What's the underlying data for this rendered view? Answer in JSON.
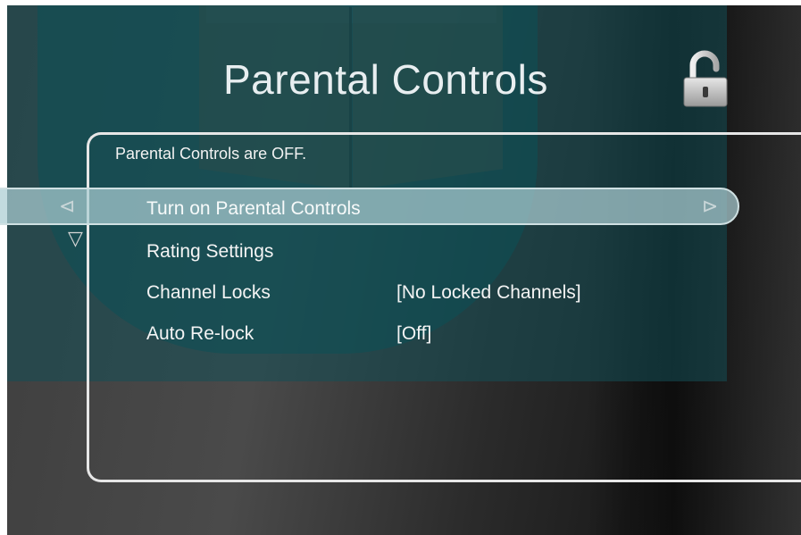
{
  "screen": {
    "title": "Parental Controls",
    "status_text": "Parental Controls are OFF.",
    "lock_icon": "unlocked-padlock-icon",
    "accent_color": "#a9cdd2",
    "nav_icons": {
      "left": "left-arrow-icon",
      "right": "right-arrow-icon",
      "down": "down-arrow-icon"
    }
  },
  "menu": {
    "items": [
      {
        "label": "Turn on Parental Controls",
        "value": "",
        "selected": true
      },
      {
        "label": "Rating Settings",
        "value": "",
        "selected": false
      },
      {
        "label": "Channel Locks",
        "value": "[No Locked Channels]",
        "selected": false
      },
      {
        "label": "Auto Re-lock",
        "value": "[Off]",
        "selected": false
      }
    ]
  }
}
